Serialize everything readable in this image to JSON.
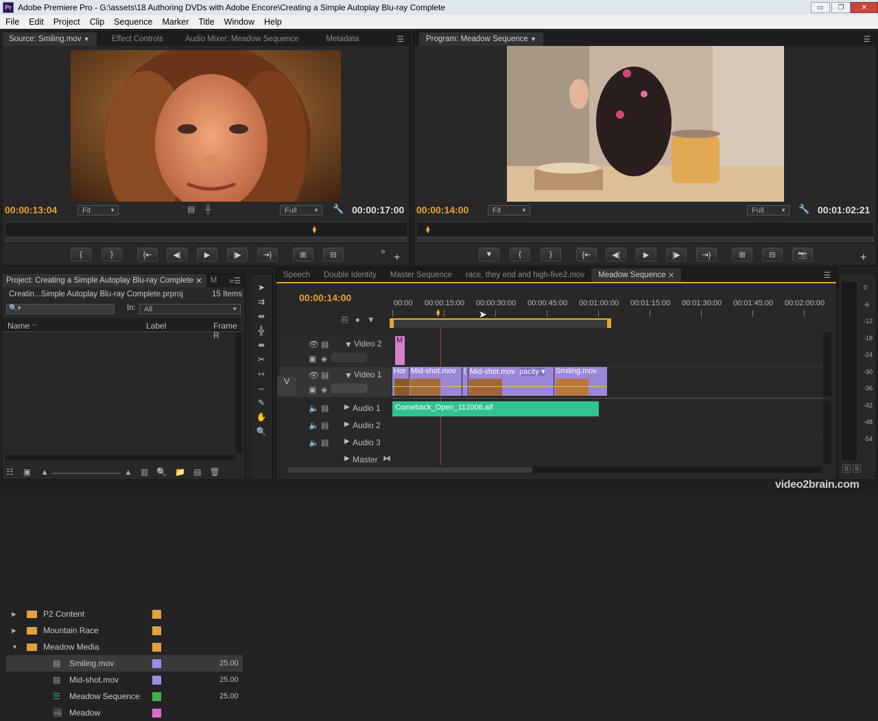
{
  "window": {
    "title": "Adobe Premiere Pro - G:\\assets\\18 Authoring DVDs with Adobe Encore\\Creating a Simple Autoplay Blu-ray Complete",
    "app_icon": "Pr",
    "minimize": "▭",
    "maximize": "❐",
    "close": "✕"
  },
  "menu": [
    "File",
    "Edit",
    "Project",
    "Clip",
    "Sequence",
    "Marker",
    "Title",
    "Window",
    "Help"
  ],
  "source_panel": {
    "tabs": [
      "Source: Smiling.mov",
      "Effect Controls",
      "Audio Mixer: Meadow Sequence",
      "Metadata"
    ],
    "timecode_current": "00:00:13:04",
    "fit": "Fit",
    "quality": "Full",
    "timecode_duration": "00:00:17:00",
    "playhead_fraction": 0.77
  },
  "program_panel": {
    "tab": "Program: Meadow Sequence",
    "timecode_current": "00:00:14:00",
    "fit": "Fit",
    "quality": "Full",
    "timecode_duration": "00:01:02:21",
    "playhead_fraction": 0.0
  },
  "project_panel": {
    "tab": "Project: Creating a Simple Autoplay Blu-ray Complete",
    "tab2": "M",
    "file": "Creatin...Simple Autoplay Blu-ray Complete.prproj",
    "count": "15 Items",
    "in_label": "In:",
    "in_value": "All",
    "col_name": "Name",
    "col_label": "Label",
    "col_frame": "Frame R",
    "items": [
      {
        "name": "P2 Content",
        "type": "folder",
        "color": "#e0a13f",
        "expand": "▶",
        "frame": ""
      },
      {
        "name": "Mountain Race",
        "type": "folder",
        "color": "#e0a13f",
        "expand": "▶",
        "frame": ""
      },
      {
        "name": "Meadow Media",
        "type": "folder",
        "color": "#e0a13f",
        "expand": "▼",
        "frame": ""
      },
      {
        "name": "Smiling.mov",
        "type": "clip",
        "color": "#9a8ee8",
        "expand": "",
        "frame": "25.00"
      },
      {
        "name": "Mid-shot.mov",
        "type": "clip",
        "color": "#9a8ee8",
        "expand": "",
        "frame": "25.00"
      },
      {
        "name": "Meadow Sequence",
        "type": "sequence",
        "color": "#3fb14e",
        "expand": "",
        "frame": "25.00"
      },
      {
        "name": "Meadow",
        "type": "image",
        "color": "#d56cd0",
        "expand": "",
        "frame": ""
      }
    ]
  },
  "timeline": {
    "tabs": [
      "Speech",
      "Double Identity",
      "Master Sequence",
      "race, they end and high-five2.mov",
      "Meadow Sequence"
    ],
    "timecode": "00:00:14:00",
    "ruler": [
      "00:00",
      "00:00:15:00",
      "00:00:30:00",
      "00:00:45:00",
      "00:01:00:00",
      "00:01:15:00",
      "00:01:30:00",
      "00:01:45:00",
      "00:02:00:00"
    ],
    "tracks": {
      "video2": "Video 2",
      "video1": "Video 1",
      "audio1": "Audio 1",
      "audio2": "Audio 2",
      "audio3": "Audio 3",
      "master": "Master",
      "v_target": "V"
    },
    "clips": {
      "v2": "M",
      "v1": [
        "Hor",
        "Mid-shot.mov",
        "(",
        "Mid-shot.mov",
        "pacity ▾",
        "Smiling.mov"
      ],
      "a1": "Comeback_Open_112006.aif"
    }
  },
  "meter": [
    "0",
    "-6",
    "-12",
    "-18",
    "-24",
    "-30",
    "-36",
    "-42",
    "-48",
    "-54"
  ],
  "meter_buttons": [
    "S",
    "S"
  ],
  "watermark": "video2brain.com"
}
